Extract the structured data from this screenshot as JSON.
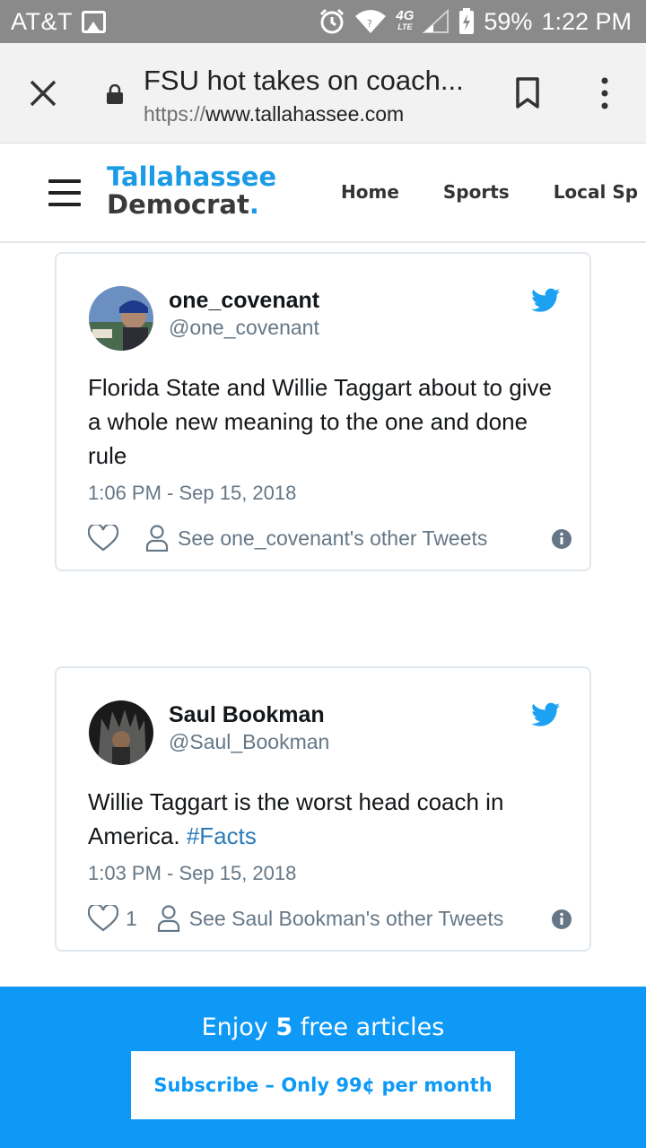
{
  "status_bar": {
    "carrier": "AT&T",
    "network": "4G",
    "battery": "59%",
    "time": "1:22 PM"
  },
  "browser": {
    "page_title": "FSU hot takes on coach...",
    "url_protocol": "https://",
    "url_host": "www.tallahassee.com"
  },
  "site": {
    "logo_line1": "Tallahassee",
    "logo_line2": "Democrat",
    "logo_dot": ".",
    "nav": [
      "Home",
      "Sports",
      "Local Sp"
    ]
  },
  "tweets": [
    {
      "name": "one_covenant",
      "handle": "@one_covenant",
      "text": "Florida State and Willie Taggart about to give a whole new meaning to the one and done rule",
      "timestamp": "1:06 PM - Sep 15, 2018",
      "likes": "",
      "other_tweets": "See one_covenant's other Tweets"
    },
    {
      "name": "Saul Bookman",
      "handle": "@Saul_Bookman",
      "text": "Willie Taggart is the worst head coach in America. ",
      "hashtag": "#Facts",
      "timestamp": "1:03 PM - Sep 15, 2018",
      "likes": "1",
      "other_tweets": "See Saul Bookman's other Tweets"
    }
  ],
  "promo": {
    "text_before": "Enjoy ",
    "count": "5",
    "text_after": " free articles",
    "button": "Subscribe – Only 99¢ per month"
  },
  "colors": {
    "twitter_blue": "#1da1f2",
    "brand_blue": "#1a9be6",
    "promo_blue": "#0d99f5",
    "status_bar_gray": "#8a8a8a"
  }
}
